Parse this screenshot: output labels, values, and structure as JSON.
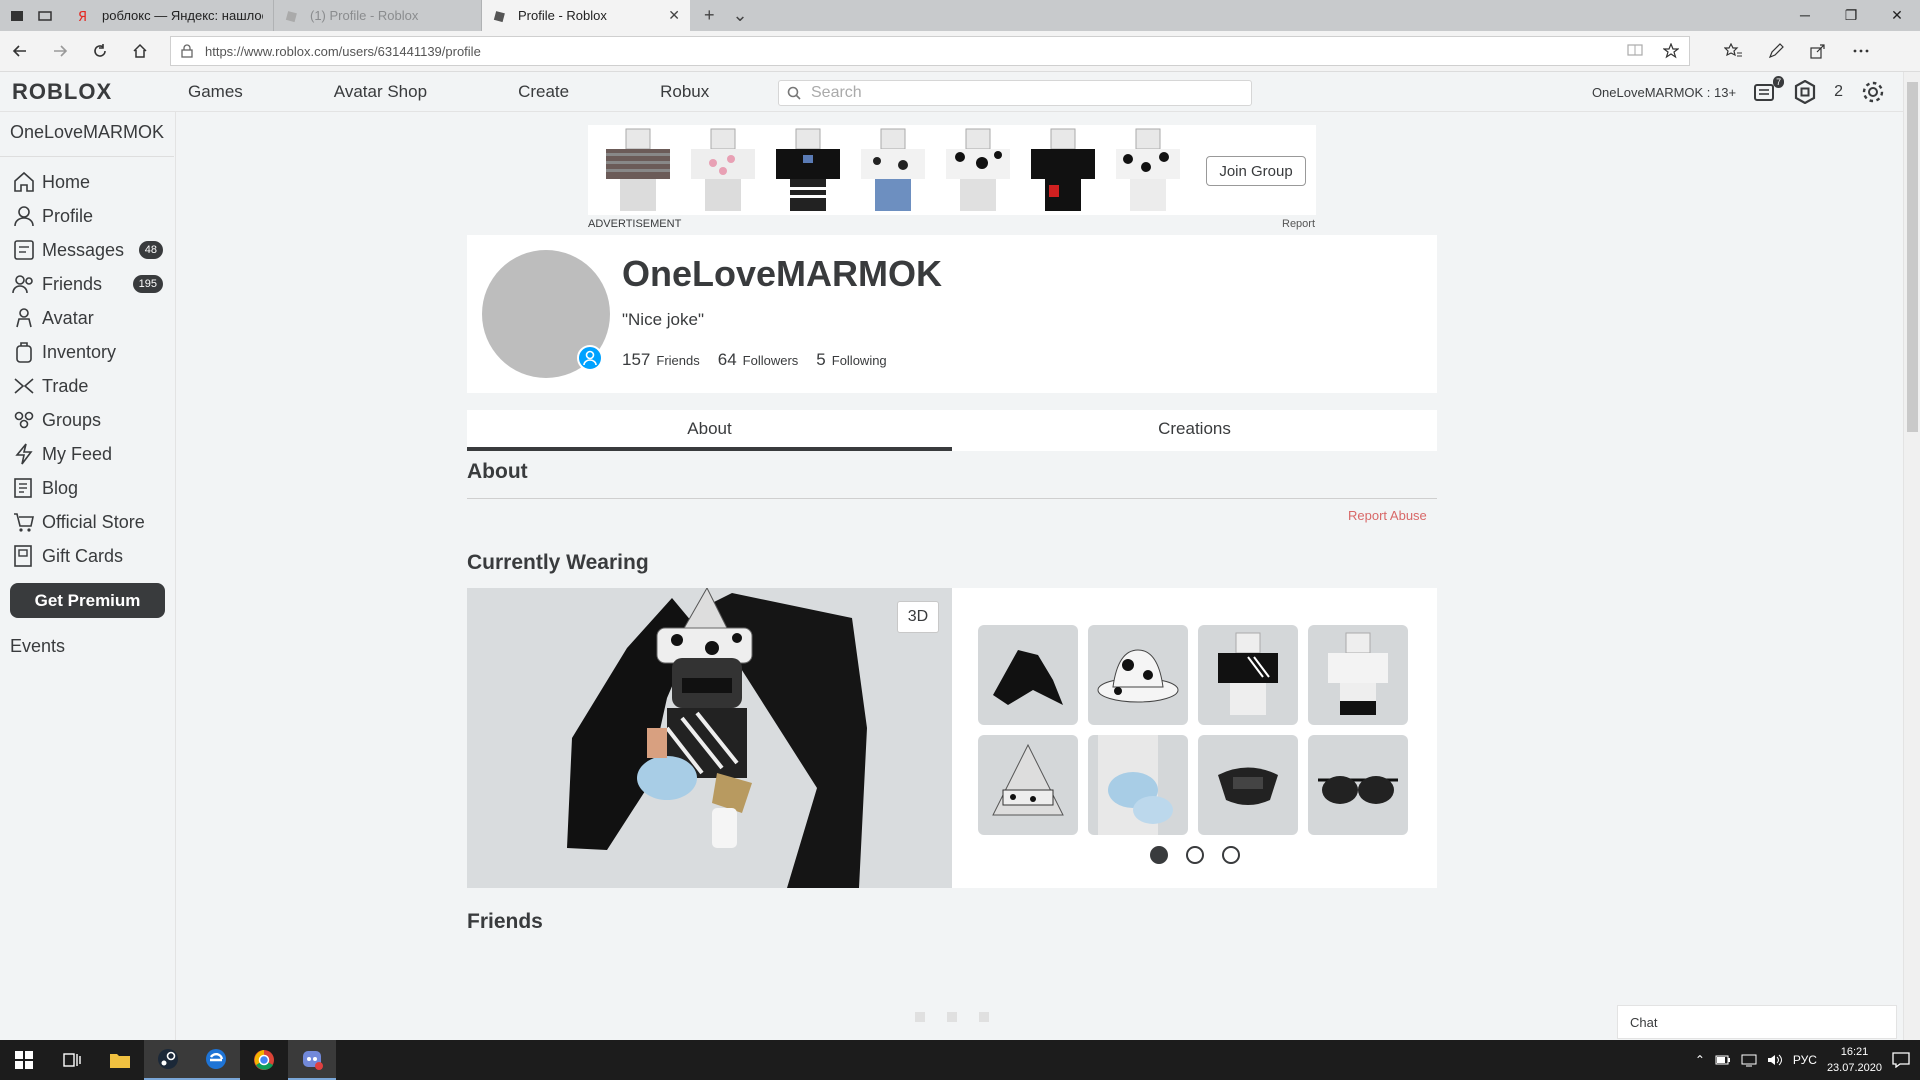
{
  "browser": {
    "tabs": [
      {
        "title": "роблокс — Яндекс: нашлос",
        "active": false
      },
      {
        "title": "(1) Profile - Roblox",
        "active": false
      },
      {
        "title": "Profile - Roblox",
        "active": true
      }
    ],
    "url": "https://www.roblox.com/users/631441139/profile"
  },
  "header": {
    "logo": "ROBLOX",
    "nav": [
      "Games",
      "Avatar Shop",
      "Create",
      "Robux"
    ],
    "search_placeholder": "Search",
    "username": "OneLoveMARMOK : 13+",
    "notifications": "7",
    "robux": "2"
  },
  "sidebar": {
    "username": "OneLoveMARMOK",
    "items": [
      {
        "label": "Home",
        "icon": "home-icon"
      },
      {
        "label": "Profile",
        "icon": "profile-icon"
      },
      {
        "label": "Messages",
        "icon": "messages-icon",
        "badge": "48"
      },
      {
        "label": "Friends",
        "icon": "friends-icon",
        "badge": "195"
      },
      {
        "label": "Avatar",
        "icon": "avatar-icon"
      },
      {
        "label": "Inventory",
        "icon": "inventory-icon"
      },
      {
        "label": "Trade",
        "icon": "trade-icon"
      },
      {
        "label": "Groups",
        "icon": "groups-icon"
      },
      {
        "label": "My Feed",
        "icon": "feed-icon"
      },
      {
        "label": "Blog",
        "icon": "blog-icon"
      },
      {
        "label": "Official Store",
        "icon": "store-icon"
      },
      {
        "label": "Gift Cards",
        "icon": "gift-card-icon"
      }
    ],
    "premium": "Get Premium",
    "events": "Events"
  },
  "ad": {
    "join": "Join Group",
    "label": "ADVERTISEMENT",
    "report": "Report"
  },
  "profile": {
    "name": "OneLoveMARMOK",
    "status": "\"Nice joke\"",
    "friends_count": "157",
    "friends_label": "Friends",
    "followers_count": "64",
    "followers_label": "Followers",
    "following_count": "5",
    "following_label": "Following"
  },
  "tabs": [
    "About",
    "Creations"
  ],
  "about": {
    "title": "About",
    "report": "Report Abuse"
  },
  "wearing": {
    "title": "Currently Wearing",
    "btn3d": "3D",
    "items": [
      "wings",
      "cow-print-hat",
      "black-shirt",
      "white-pants",
      "pyramid-hat",
      "ice-feet",
      "mask",
      "sunglasses"
    ]
  },
  "friends": {
    "title": "Friends"
  },
  "chat": "Chat",
  "taskbar": {
    "lang": "РУС",
    "time": "16:21",
    "date": "23.07.2020"
  }
}
